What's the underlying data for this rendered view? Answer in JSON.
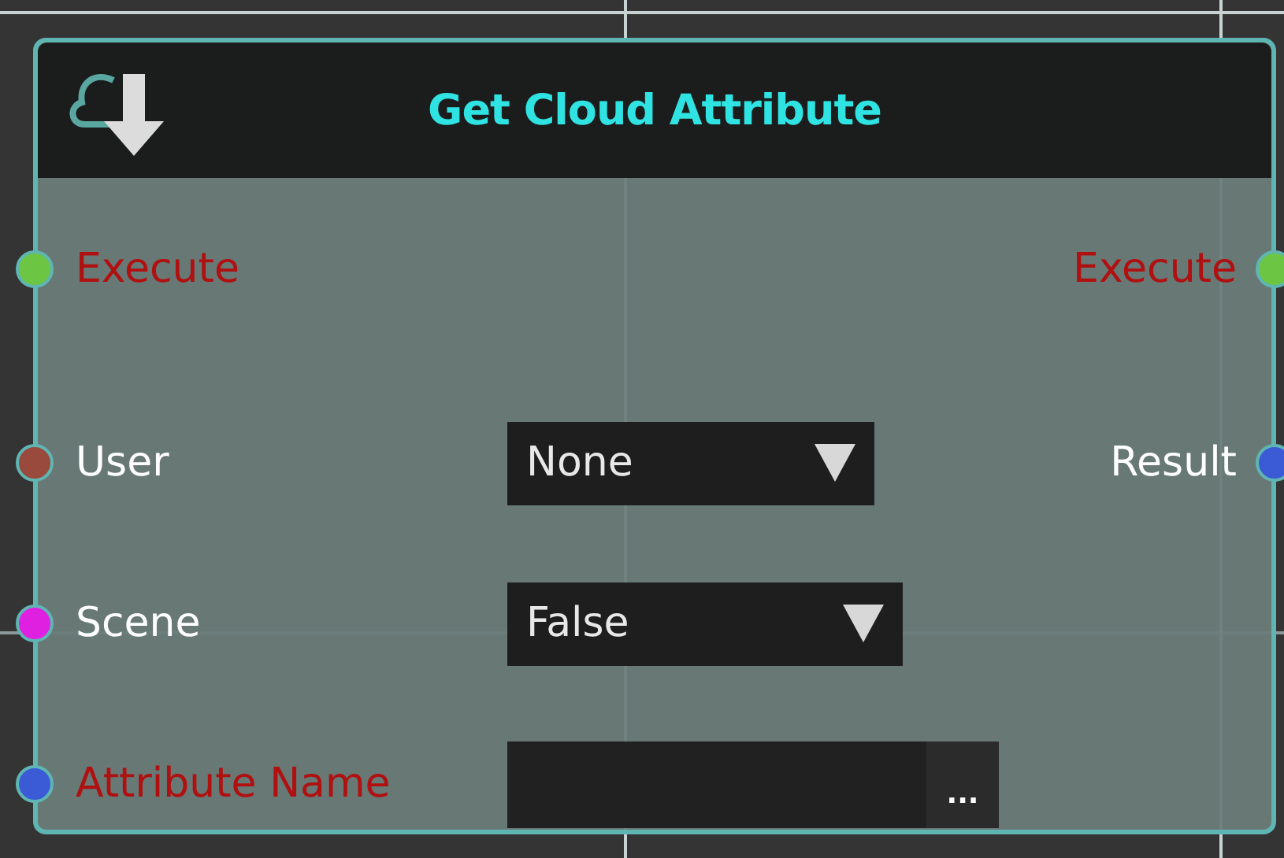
{
  "node": {
    "title": "Get Cloud Attribute",
    "rows": [
      {
        "input": {
          "label": "Execute",
          "required": true,
          "color": "#6cc644"
        },
        "output": {
          "label": "Execute",
          "required": true,
          "color": "#6cc644"
        }
      },
      {
        "input": {
          "label": "User",
          "required": false,
          "color": "#9a4a3c"
        },
        "control": {
          "kind": "dropdown",
          "value": "None",
          "wide": false
        },
        "output": {
          "label": "Result",
          "required": false,
          "color": "#3b5bd6"
        }
      },
      {
        "input": {
          "label": "Scene",
          "required": false,
          "color": "#e020e0"
        },
        "control": {
          "kind": "dropdown",
          "value": "False",
          "wide": true
        }
      },
      {
        "input": {
          "label": "Attribute Name",
          "required": true,
          "color": "#3b5bd6"
        },
        "control": {
          "kind": "text",
          "button": "..."
        }
      }
    ]
  }
}
